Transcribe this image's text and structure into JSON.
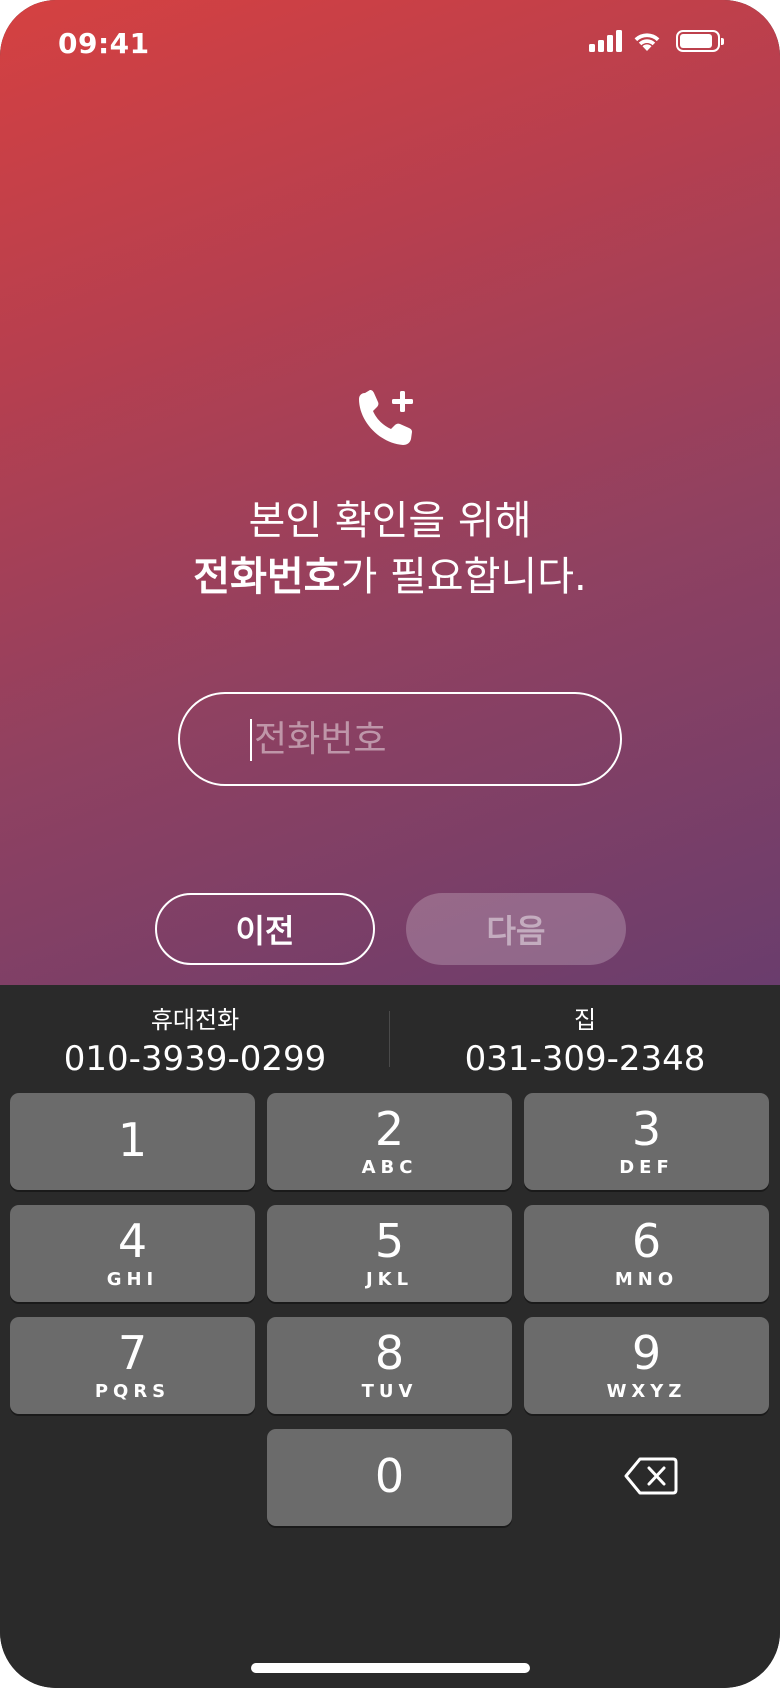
{
  "status_bar": {
    "time": "09:41",
    "icons": [
      "cellular-signal-icon",
      "wifi-icon",
      "battery-icon"
    ],
    "battery_level": 0.9
  },
  "header": {
    "icon": "phone-add-icon",
    "line1": "본인 확인을 위해",
    "line2_bold": "전화번호",
    "line2_rest": "가 필요합니다."
  },
  "phone_field": {
    "placeholder": "전화번호",
    "value": ""
  },
  "buttons": {
    "prev_label": "이전",
    "next_label": "다음",
    "next_enabled": false
  },
  "suggestions": [
    {
      "label": "휴대전화",
      "number": "010-3939-0299"
    },
    {
      "label": "집",
      "number": "031-309-2348"
    }
  ],
  "keypad": {
    "keys": [
      {
        "digit": "1",
        "letters": ""
      },
      {
        "digit": "2",
        "letters": "ABC"
      },
      {
        "digit": "3",
        "letters": "DEF"
      },
      {
        "digit": "4",
        "letters": "GHI"
      },
      {
        "digit": "5",
        "letters": "JKL"
      },
      {
        "digit": "6",
        "letters": "MNO"
      },
      {
        "digit": "7",
        "letters": "PQRS"
      },
      {
        "digit": "8",
        "letters": "TUV"
      },
      {
        "digit": "9",
        "letters": "WXYZ"
      },
      {
        "digit": "0",
        "letters": ""
      }
    ],
    "delete_icon": "backspace-icon"
  },
  "colors": {
    "gradient_start": "#d54141",
    "gradient_end": "#6a3d6d",
    "keyboard_bg": "#2a2a2a",
    "key_bg": "#6b6b6b"
  }
}
